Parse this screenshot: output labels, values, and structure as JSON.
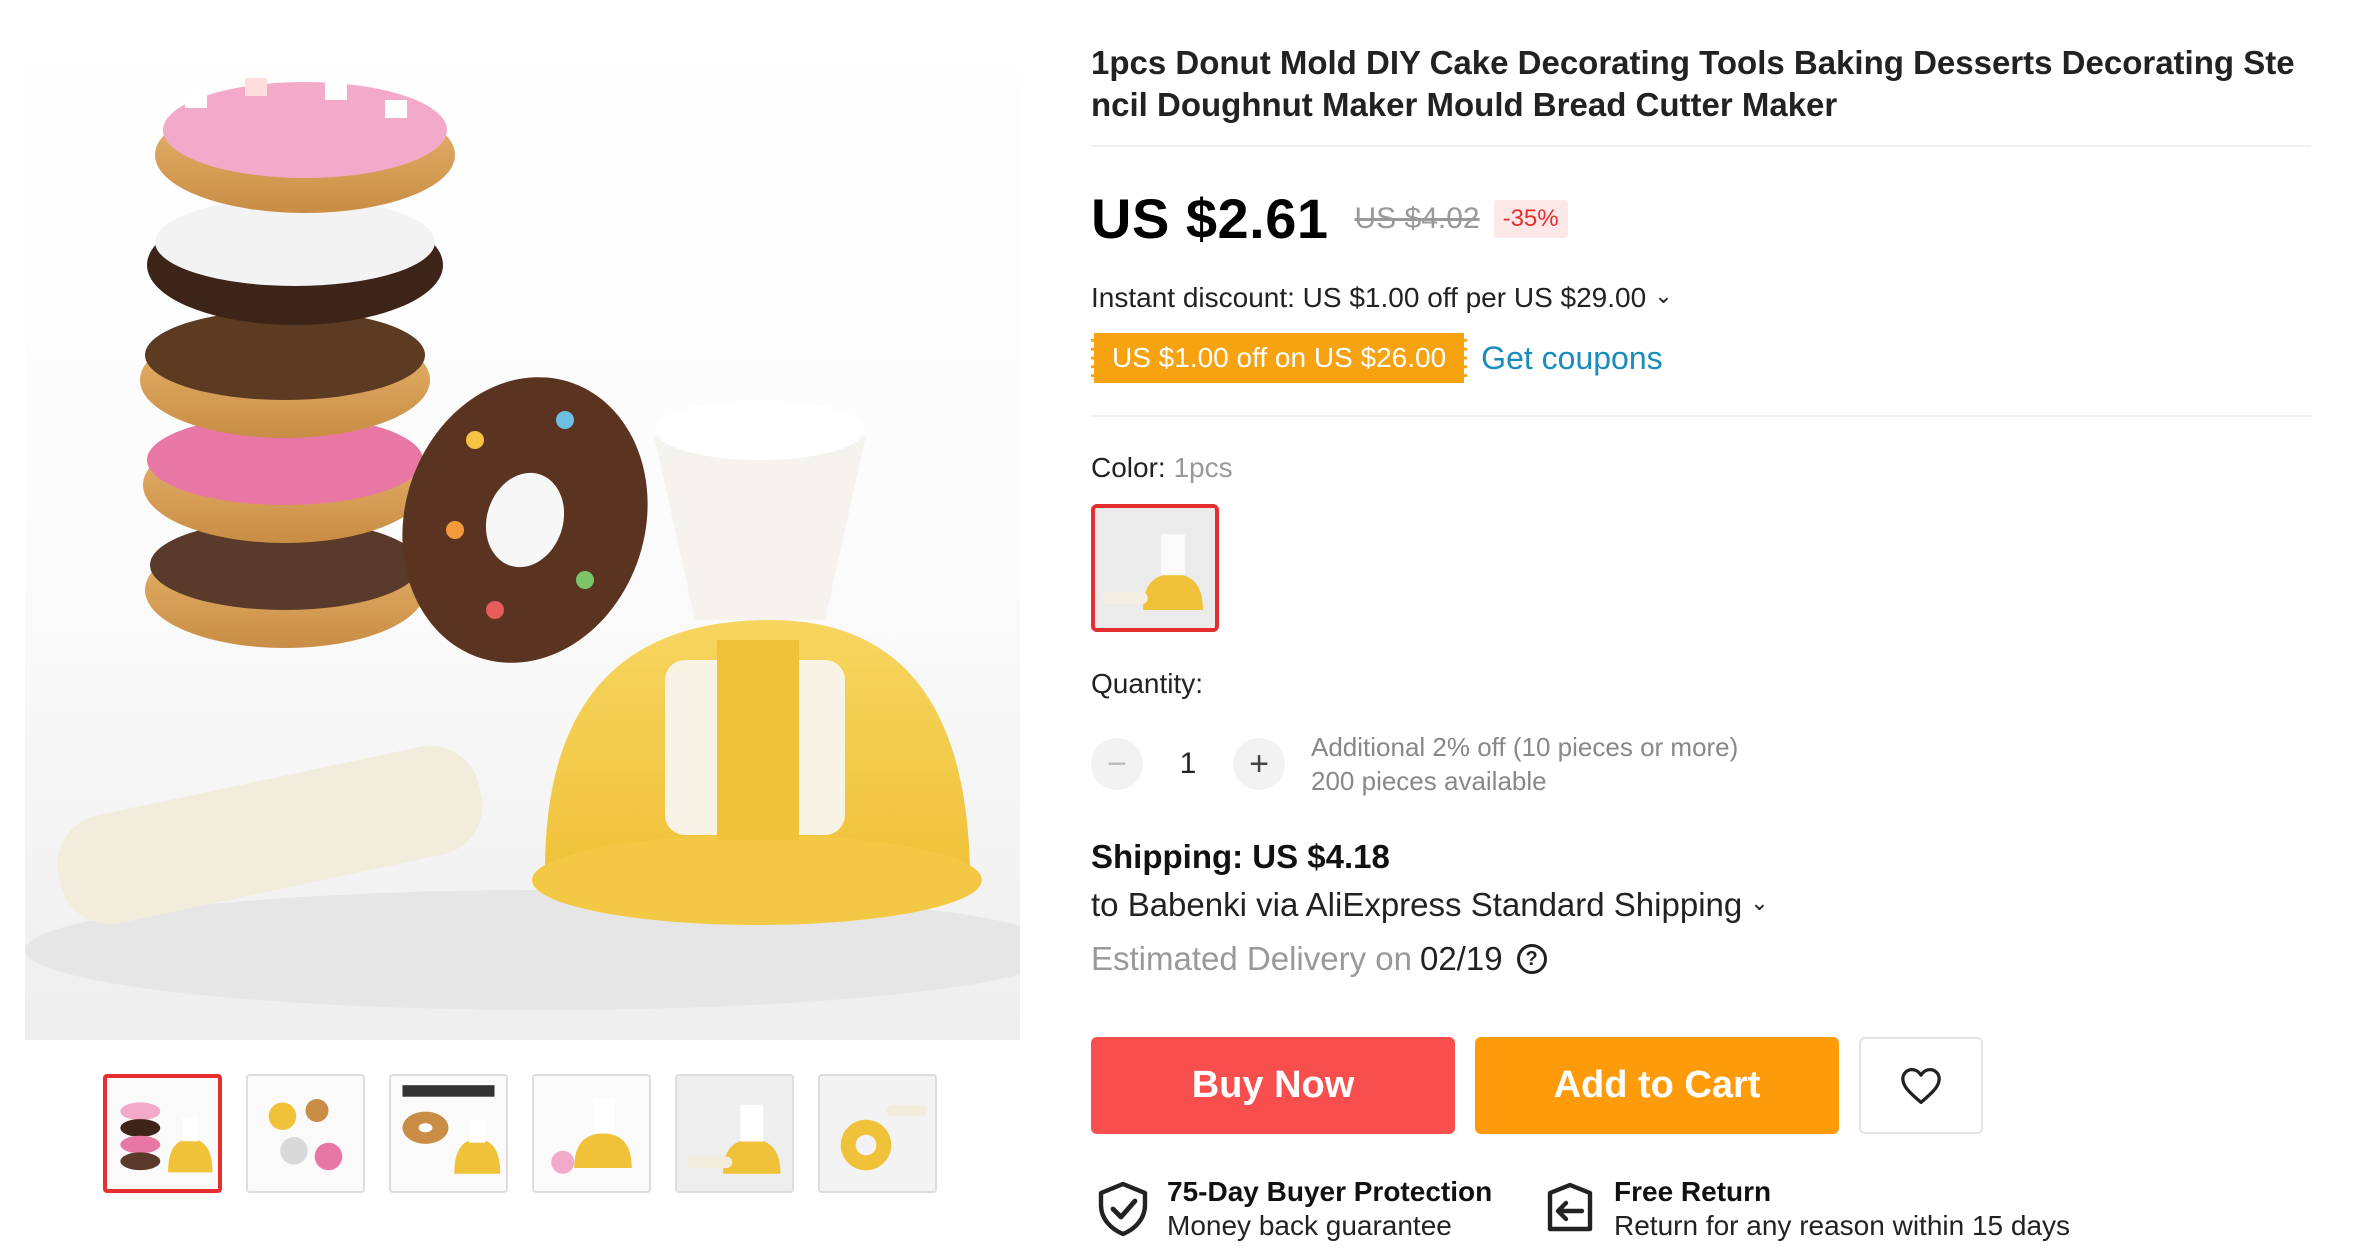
{
  "product": {
    "title": "1pcs Donut Mold DIY Cake Decorating Tools Baking Desserts Decorating Stencil Doughnut Maker Mould Bread Cutter Maker"
  },
  "price": {
    "current": "US $2.61",
    "original": "US $4.02",
    "discount": "-35%"
  },
  "promotion": {
    "instant_discount": "Instant discount: US $1.00 off per US $29.00",
    "coupon": "US $1.00 off on US $26.00",
    "coupon_link": "Get coupons"
  },
  "variant": {
    "label": "Color:",
    "value": "1pcs"
  },
  "quantity": {
    "label": "Quantity:",
    "value": "1",
    "minus": "−",
    "plus": "+",
    "note_discount": "Additional 2% off (10 pieces or more)",
    "note_available": "200 pieces available"
  },
  "shipping": {
    "title": "Shipping: US $4.18",
    "route": "to Babenki via AliExpress Standard Shipping",
    "delivery_label": "Estimated Delivery on",
    "delivery_date": "02/19",
    "help": "?"
  },
  "actions": {
    "buy_now": "Buy Now",
    "add_to_cart": "Add to Cart"
  },
  "assurances": [
    {
      "title": "75-Day Buyer Protection",
      "subtitle": "Money back guarantee",
      "icon": "shield-check-icon"
    },
    {
      "title": "Free Return",
      "subtitle": "Return for any reason within 15 days",
      "icon": "return-box-icon"
    }
  ],
  "colors": {
    "accent_red": "#e62e2e",
    "buy_now": "#f84e4e",
    "add_to_cart": "#fd9b0b",
    "coupon": "#f7a211",
    "link": "#1a8bbd"
  },
  "gallery": {
    "thumbnail_count": 6,
    "active_index": 0
  }
}
